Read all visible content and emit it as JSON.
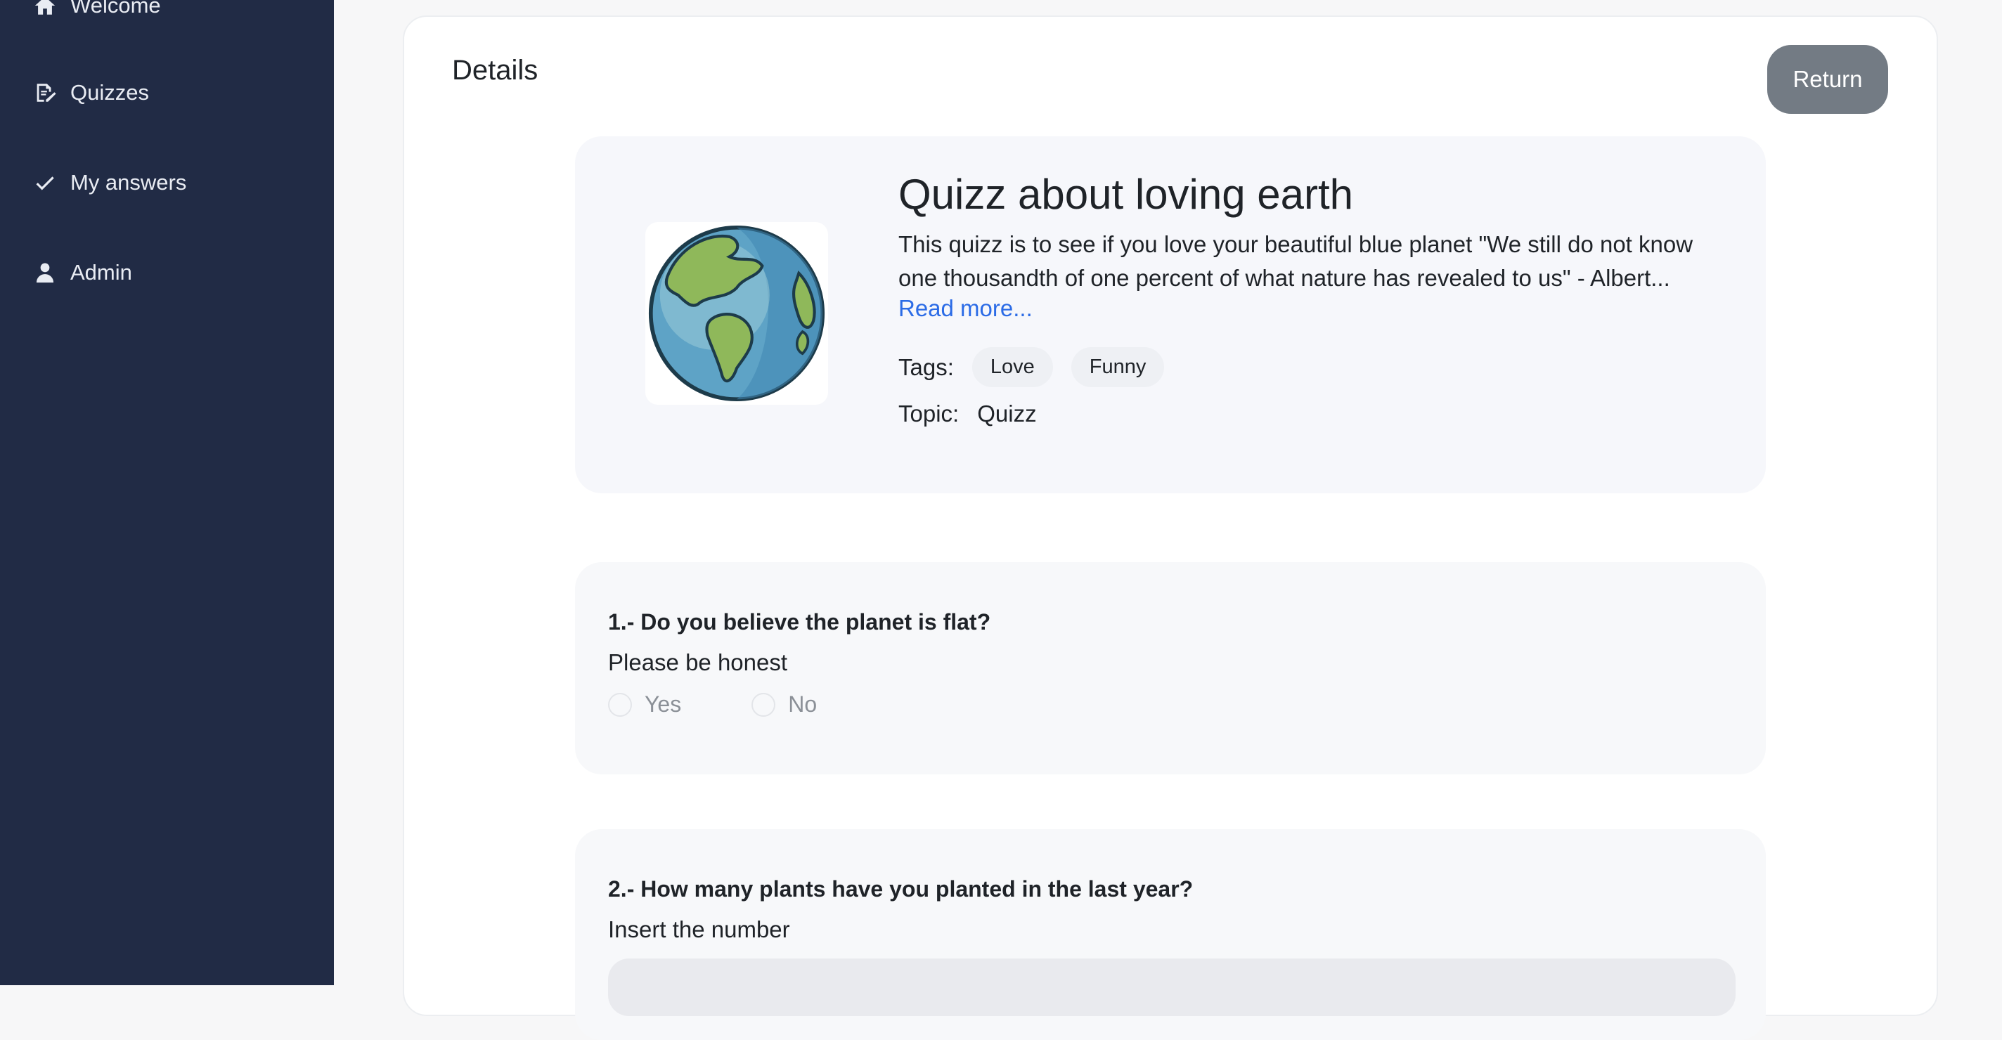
{
  "sidebar": {
    "items": [
      {
        "label": "Welcome",
        "icon": "home-icon"
      },
      {
        "label": "Quizzes",
        "icon": "edit-document-icon"
      },
      {
        "label": "My answers",
        "icon": "check-icon"
      },
      {
        "label": "Admin",
        "icon": "user-icon"
      }
    ]
  },
  "main": {
    "title": "Details",
    "return_label": "Return"
  },
  "quiz": {
    "title": "Quizz about loving earth",
    "description": "This quizz is to see if you love your beautiful blue planet \"We still do not know one thousandth of one percent of what nature has revealed to us\" - Albert...",
    "read_more": "Read more...",
    "tags_label": "Tags:",
    "tags": [
      "Love",
      "Funny"
    ],
    "topic_label": "Topic:",
    "topic": "Quizz",
    "image_icon": "earth-globe-icon"
  },
  "questions": [
    {
      "title": "1.- Do you believe the planet is flat?",
      "subtitle": "Please be honest",
      "options": [
        "Yes",
        "No"
      ]
    },
    {
      "title": "2.- How many plants have you planted in the last year?",
      "subtitle": "Insert the number",
      "input_value": ""
    }
  ]
}
